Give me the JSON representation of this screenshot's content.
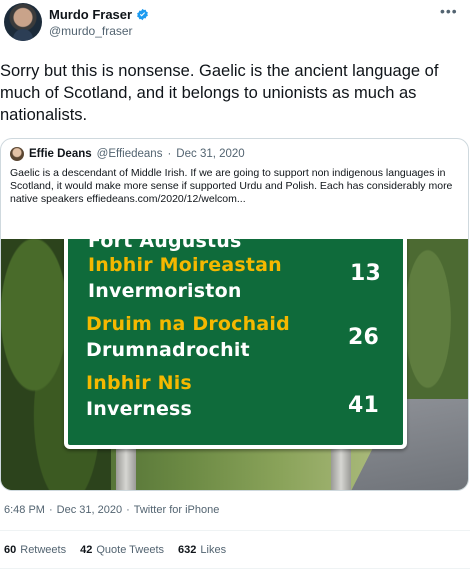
{
  "author": {
    "display_name": "Murdo Fraser",
    "handle": "@murdo_fraser",
    "verified_icon": "verified-badge-icon",
    "more_icon": "more-options-icon"
  },
  "tweet": {
    "text": "Sorry but this is nonsense. Gaelic is the ancient language of much of Scotland, and it belongs to unionists as much as nationalists."
  },
  "quote": {
    "display_name": "Effie Deans",
    "handle": "@Effiedeans",
    "separator": "·",
    "date": "Dec 31, 2020",
    "text": "Gaelic is a descendant of Middle Irish. If we are going to support non indigenous languages in Scotland, it would make more sense if supported Urdu and Polish. Each has considerably more native speakers effiedeans.com/2020/12/welcom...",
    "sign": {
      "partial_top": "Fort Augustus",
      "lines": [
        {
          "gaelic": "Inbhir Moireastan",
          "english": "Invermoriston",
          "distance": "13"
        },
        {
          "gaelic": "Druim na Drochaid",
          "english": "Drumnadrochit",
          "distance": "26"
        },
        {
          "gaelic": "Inbhir Nis",
          "english": "Inverness",
          "distance": "41"
        }
      ]
    }
  },
  "meta": {
    "time": "6:48 PM",
    "separator1": "·",
    "date": "Dec 31, 2020",
    "separator2": "·",
    "source": "Twitter for iPhone"
  },
  "stats": {
    "retweets_count": "60",
    "retweets_label": "Retweets",
    "quotes_count": "42",
    "quotes_label": "Quote Tweets",
    "likes_count": "632",
    "likes_label": "Likes"
  },
  "colors": {
    "verified": "#1d9bf0",
    "text_primary": "#0f1419",
    "text_secondary": "#536471",
    "sign_green": "#0f6b3b",
    "sign_yellow": "#f5b800"
  }
}
